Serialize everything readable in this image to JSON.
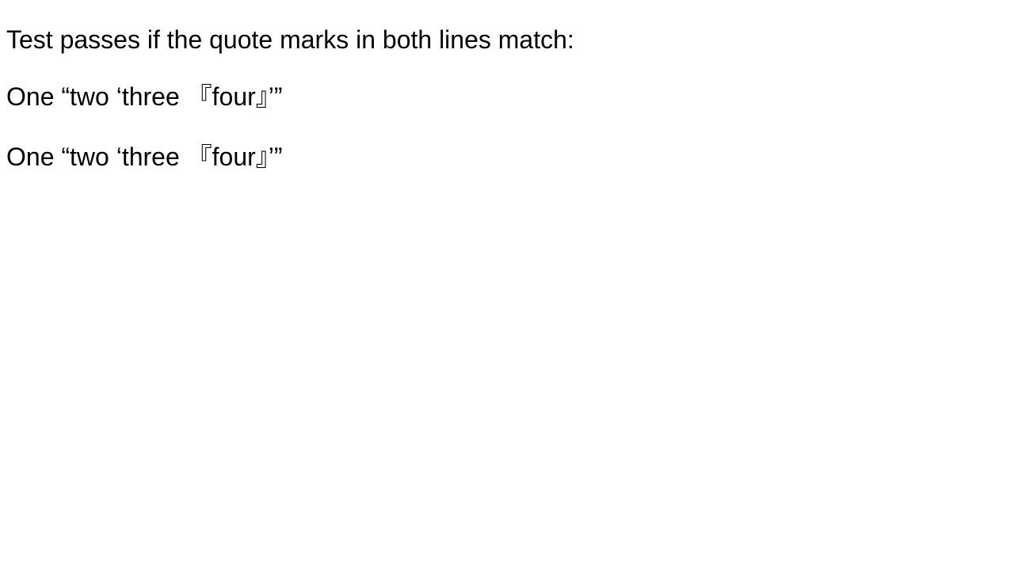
{
  "instruction": "Test passes if the quote marks in both lines match:",
  "lines": [
    "One “two ‘three 『four』’”",
    "One “two ‘three 『four』’”"
  ]
}
